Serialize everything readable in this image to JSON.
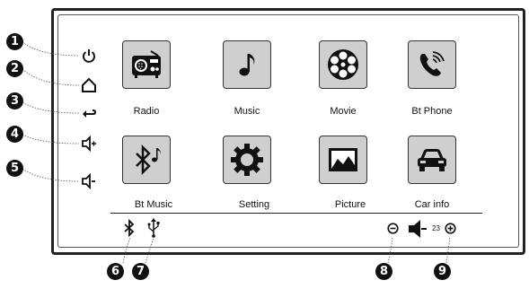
{
  "apps": [
    {
      "label": "Radio",
      "icon": "radio-icon"
    },
    {
      "label": "Music",
      "icon": "music-note-icon"
    },
    {
      "label": "Movie",
      "icon": "film-reel-icon"
    },
    {
      "label": "Bt Phone",
      "icon": "phone-icon"
    },
    {
      "label": "Bt Music",
      "icon": "bluetooth-music-icon"
    },
    {
      "label": "Setting",
      "icon": "gear-icon"
    },
    {
      "label": "Picture",
      "icon": "picture-icon"
    },
    {
      "label": "Car info",
      "icon": "car-icon"
    }
  ],
  "side_buttons": [
    {
      "callout": "1",
      "icon": "power-icon"
    },
    {
      "callout": "2",
      "icon": "home-icon"
    },
    {
      "callout": "3",
      "icon": "back-icon"
    },
    {
      "callout": "4",
      "icon": "volume-up-icon"
    },
    {
      "callout": "5",
      "icon": "volume-down-icon"
    }
  ],
  "status_bar": {
    "bluetooth_callout": "6",
    "usb_callout": "7",
    "volume_down_callout": "8",
    "volume_up_callout": "9",
    "volume_level": "23"
  }
}
